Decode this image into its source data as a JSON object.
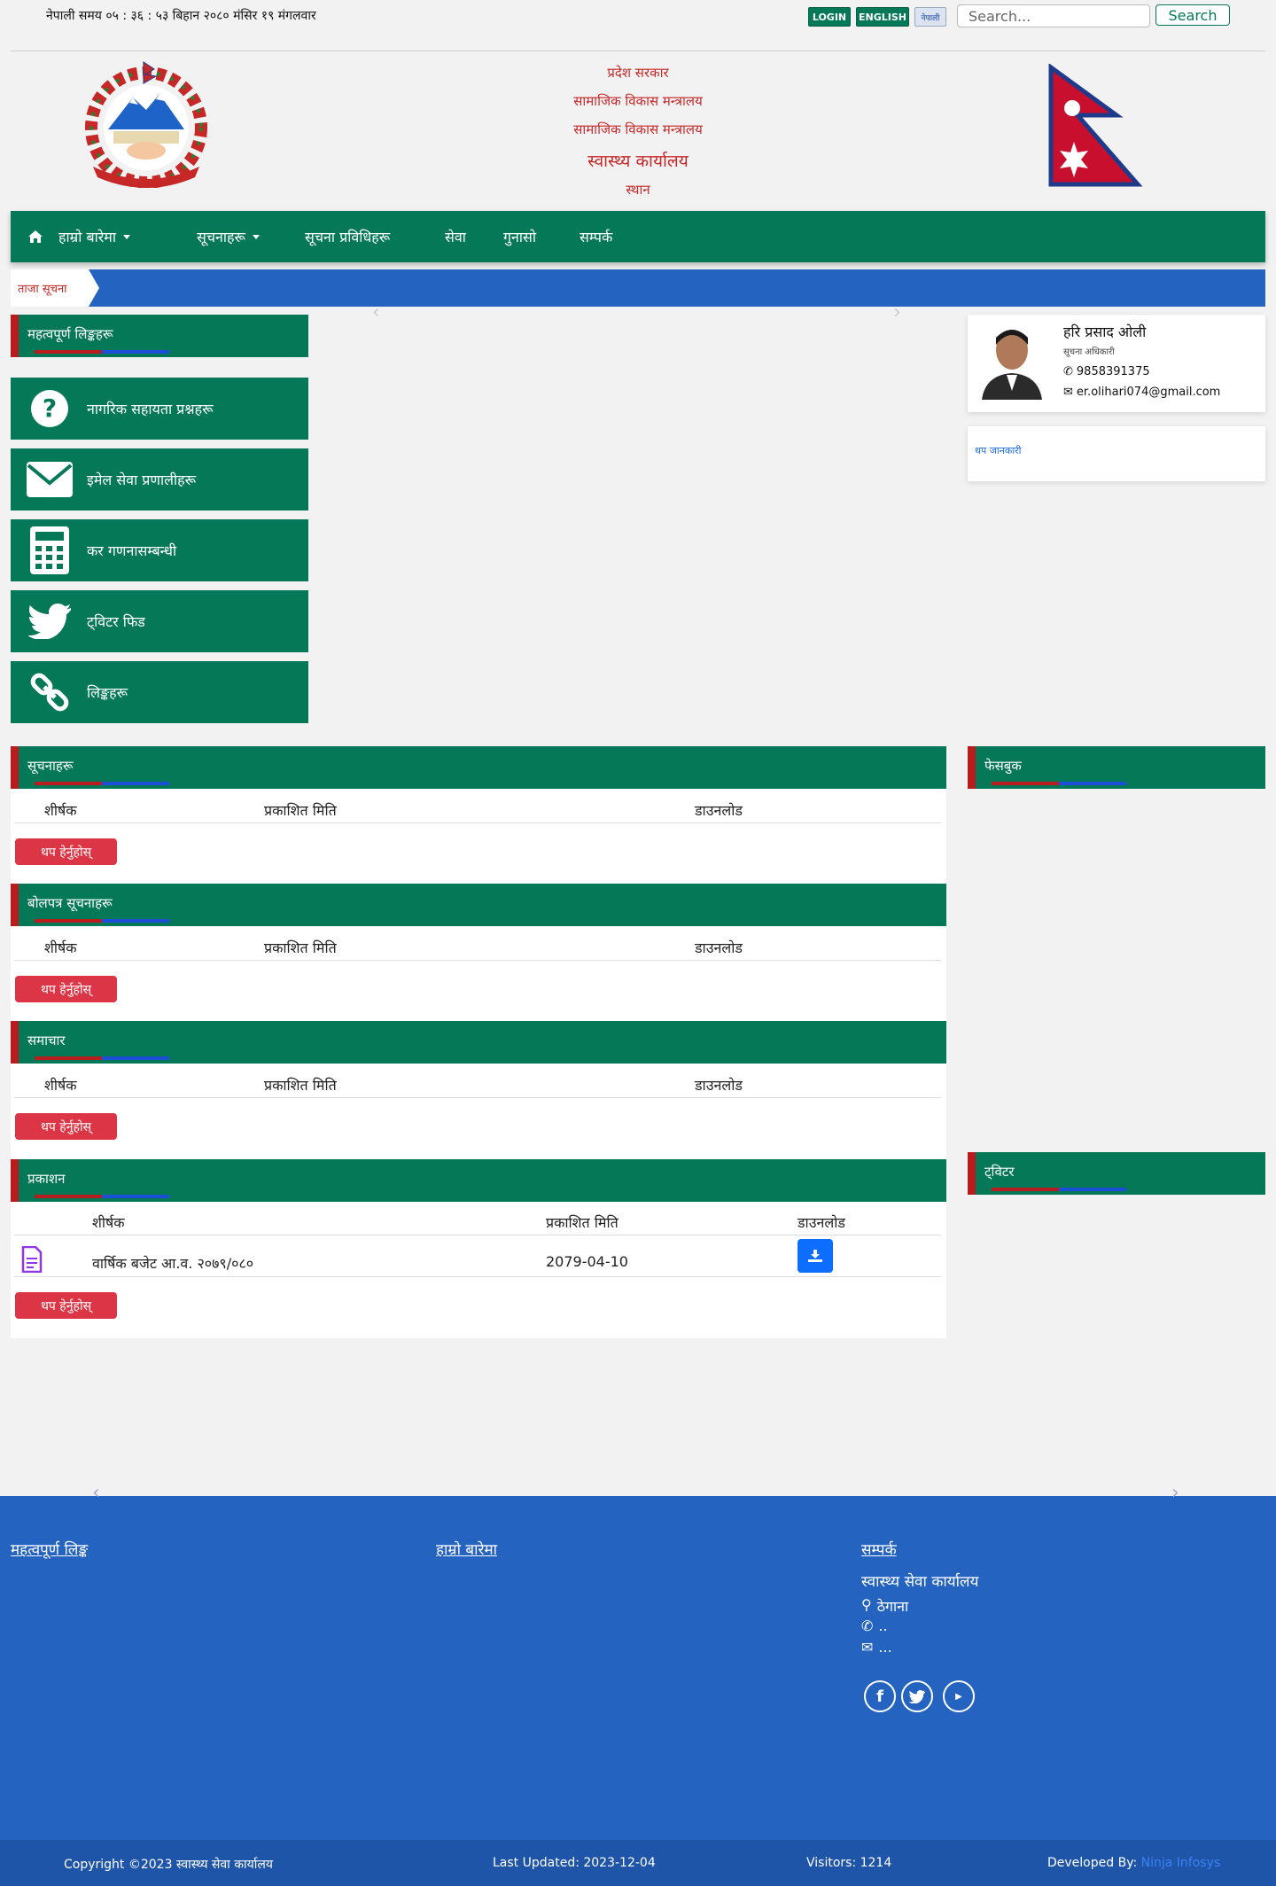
{
  "topbar": {
    "datetime": "नेपाली समय ०५ : ३६ : ५३ बिहान  २०८० मंसिर १९ मंगलवार",
    "login_label": "LOGIN",
    "english_label": "ENGLISH",
    "nepali_label": "नेपाली",
    "search_placeholder": "Search...",
    "search_button": "Search"
  },
  "header": {
    "line1": "प्रदेश सरकार",
    "line2": "सामाजिक विकास मन्त्रालय",
    "line3": "सामाजिक विकास मन्त्रालय",
    "office_name": "स्वास्थ्य कार्यालय",
    "location": "स्थान"
  },
  "nav": {
    "home_icon": "home-icon",
    "items": [
      {
        "label": "हाम्रो बारेमा",
        "dropdown": true
      },
      {
        "label": "सूचनाहरू",
        "dropdown": true
      },
      {
        "label": "सूचना प्रविधिहरू",
        "dropdown": false
      },
      {
        "label": "सेवा",
        "dropdown": false
      },
      {
        "label": "गुनासो",
        "dropdown": false
      },
      {
        "label": "सम्पर्क",
        "dropdown": false
      }
    ]
  },
  "ticker": {
    "label": "ताजा सूचना"
  },
  "left_panel": {
    "heading": "महत्वपूर्ण लिङ्कहरू",
    "tiles": [
      {
        "label": "नागरिक सहायता प्रश्नहरू",
        "icon": "question-circle-icon"
      },
      {
        "label": "इमेल सेवा प्रणालीहरू",
        "icon": "envelope-icon"
      },
      {
        "label": "कर गणनासम्बन्धी",
        "icon": "calculator-icon"
      },
      {
        "label": "ट्विटर फिड",
        "icon": "twitter-icon"
      },
      {
        "label": "लिङ्कहरू",
        "icon": "link-icon"
      }
    ]
  },
  "profile": {
    "name": "हरि प्रसाद ओली",
    "role": "सूचना अधिकारी",
    "phone": "9858391375",
    "email": "er.olihari074@gmail.com",
    "more_link": "थप जानकारी"
  },
  "sections": [
    {
      "title": "सूचनाहरू",
      "col1": "शीर्षक",
      "col2": "प्रकाशित मिति",
      "col3": "डाउनलोड",
      "button": "थप हेर्नुहोस्"
    },
    {
      "title": "बोलपत्र सूचनाहरू",
      "col1": "शीर्षक",
      "col2": "प्रकाशित मिति",
      "col3": "डाउनलोड",
      "button": "थप हेर्नुहोस्"
    },
    {
      "title": "समाचार",
      "col1": "शीर्षक",
      "col2": "प्रकाशित मिति",
      "col3": "डाउनलोड",
      "button": "थप हेर्नुहोस्"
    },
    {
      "title": "प्रकाशन",
      "col1": "शीर्षक",
      "col2": "प्रकाशित मिति",
      "col3": "डाउनलोड",
      "button": "थप हेर्नुहोस्",
      "rows": [
        {
          "title": "वार्षिक बजेट आ.व. २०७९/०८०",
          "date": "2079-04-10",
          "icon": "file-text-icon",
          "download_icon": "download-icon"
        }
      ]
    }
  ],
  "right_sections": [
    {
      "title": "फेसबुक"
    },
    {
      "title": "ट्विटर"
    }
  ],
  "footer": {
    "col1_title": "महत्वपूर्ण लिङ्क",
    "col2_title": "हाम्रो बारेमा",
    "col3_title": "सम्पर्क",
    "office": "स्वास्थ्य सेवा कार्यालय",
    "address": "ठेगाना",
    "phone": "..",
    "email": "...",
    "social": [
      "facebook-icon",
      "twitter-icon",
      "youtube-icon"
    ]
  },
  "bottom": {
    "copyright": "Copyright ©2023 स्वास्थ्य सेवा कार्यालय",
    "updated": "Last Updated: 2023-12-04",
    "visitors": "Visitors: 1214",
    "developed_prefix": "Developed By:",
    "developer": "Ninja Infosys"
  },
  "colors": {
    "green": "#047857",
    "red": "#b91c1c",
    "blue": "#2563c0"
  }
}
